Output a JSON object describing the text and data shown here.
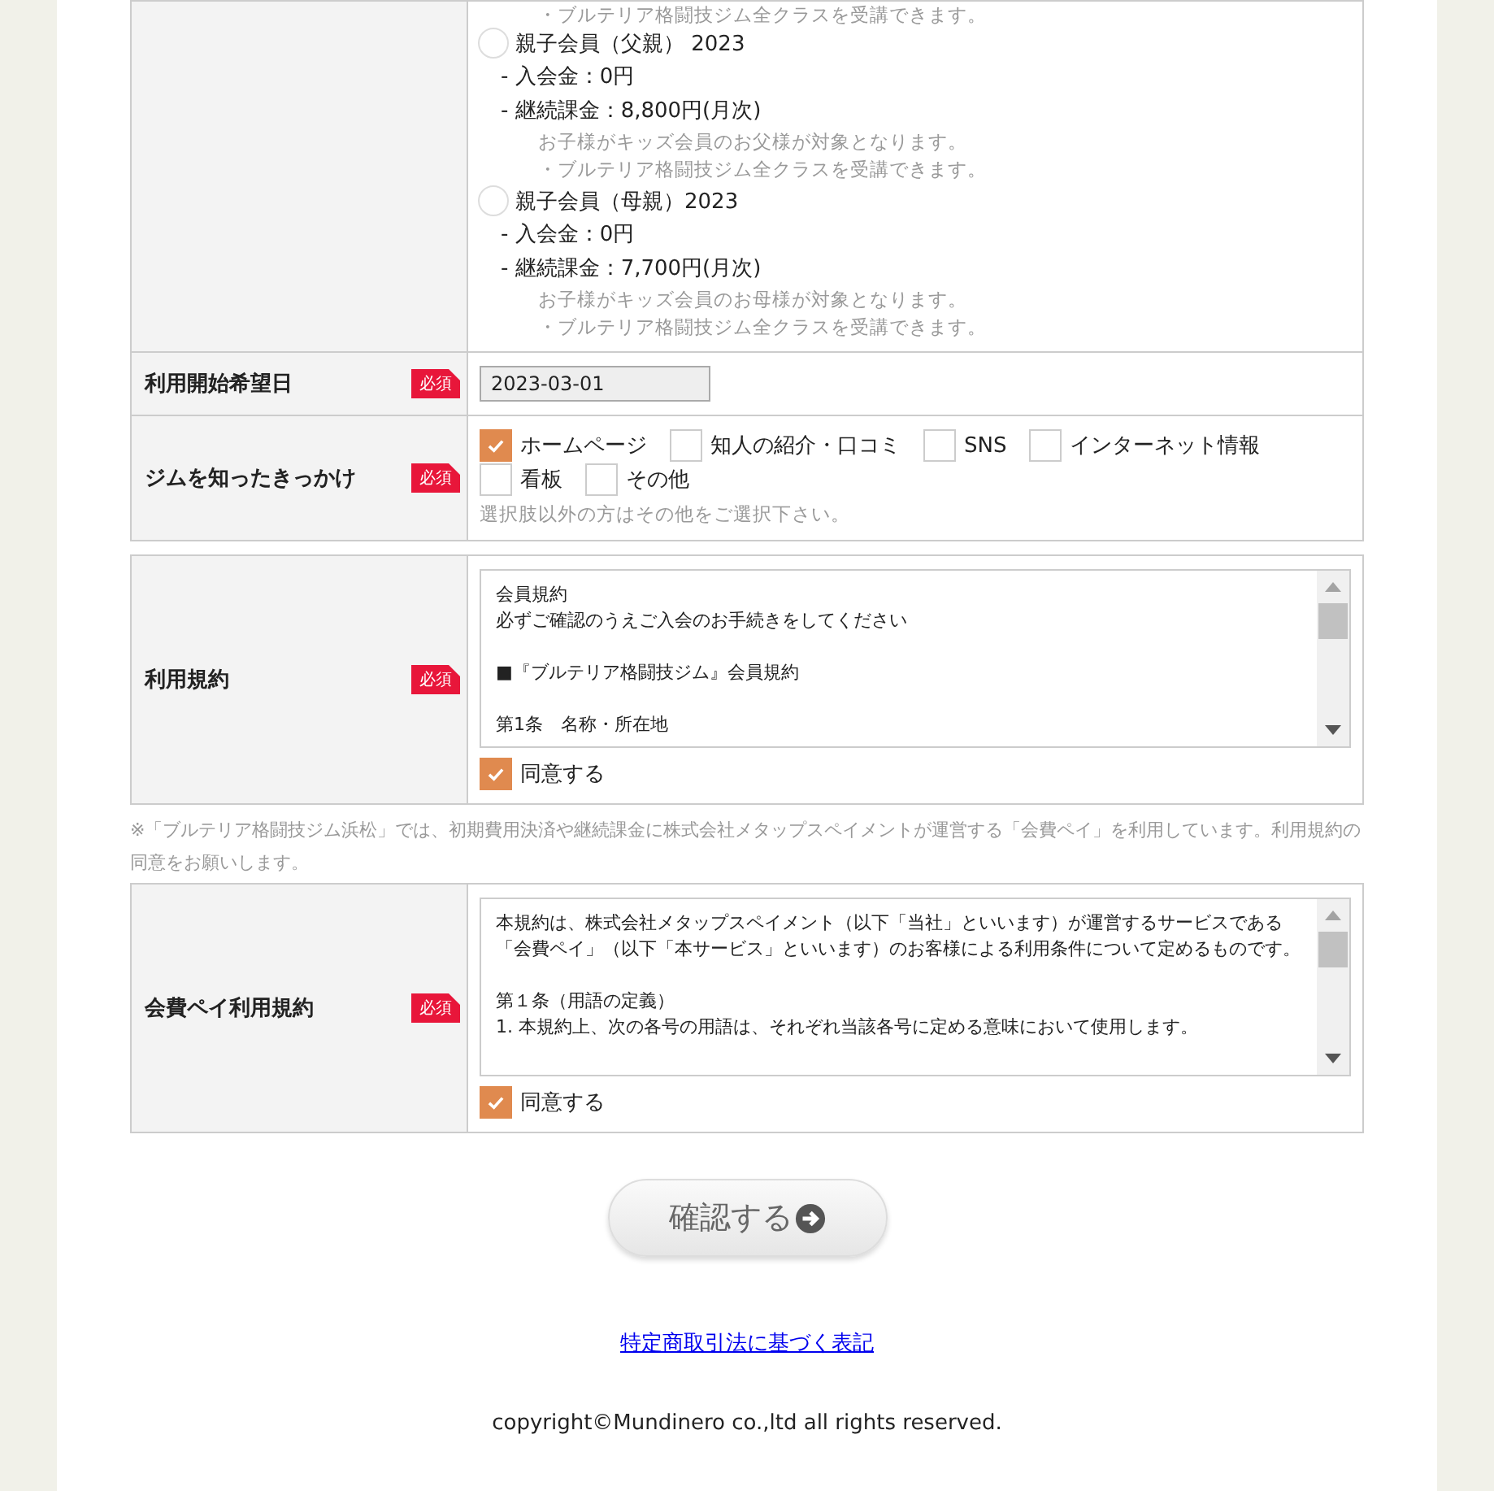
{
  "plans_top_note": "・ブルテリア格闘技ジム全クラスを受講できます。",
  "plans": [
    {
      "name": "親子会員（父親） 2023",
      "selected": false,
      "fees": [
        "- 入会金：0円",
        "- 継続課金：8,800円(月次)"
      ],
      "notes": [
        "お子様がキッズ会員のお父様が対象となります。",
        "・ブルテリア格闘技ジム全クラスを受講できます。"
      ]
    },
    {
      "name": "親子会員（母親）2023",
      "selected": false,
      "fees": [
        "- 入会金：0円",
        "- 継続課金：7,700円(月次)"
      ],
      "notes": [
        "お子様がキッズ会員のお母様が対象となります。",
        "・ブルテリア格闘技ジム全クラスを受講できます。"
      ]
    }
  ],
  "start_date": {
    "label": "利用開始希望日",
    "required": "必須",
    "value": "2023-03-01"
  },
  "referral": {
    "label": "ジムを知ったきっかけ",
    "required": "必須",
    "options": [
      {
        "label": "ホームページ",
        "checked": true
      },
      {
        "label": "知人の紹介・口コミ",
        "checked": false
      },
      {
        "label": "SNS",
        "checked": false
      },
      {
        "label": "インターネット情報",
        "checked": false
      },
      {
        "label": "看板",
        "checked": false
      },
      {
        "label": "その他",
        "checked": false
      }
    ],
    "hint": "選択肢以外の方はその他をご選択下さい。"
  },
  "terms": {
    "label": "利用規約",
    "required": "必須",
    "paragraphs": [
      [
        "会員規約",
        "必ずご確認のうえご入会のお手続きをしてください"
      ],
      [
        "■『ブルテリア格闘技ジム』会員規約"
      ],
      [
        "第1条　名称・所在地"
      ]
    ],
    "agree": {
      "label": "同意する",
      "checked": true
    }
  },
  "notice": "※「ブルテリア格闘技ジム浜松」では、初期費用決済や継続課金に株式会社メタップスペイメントが運営する「会費ペイ」を利用しています。利用規約の同意をお願いします。",
  "payment_terms": {
    "label": "会費ペイ利用規約",
    "required": "必須",
    "paragraphs": [
      [
        "本規約は、株式会社メタップスペイメント（以下「当社」といいます）が運営するサービスである「会費ペイ」（以下「本サービス」といいます）のお客様による利用条件について定めるものです。"
      ],
      [
        "第１条（用語の定義）",
        "1. 本規約上、次の各号の用語は、それぞれ当該各号に定める意味において使用します。"
      ]
    ],
    "agree": {
      "label": "同意する",
      "checked": true
    }
  },
  "confirm_button": "確認する",
  "legal_link": "特定商取引法に基づく表記",
  "copyright": "copyright©Mundinero co.,ltd all rights reserved."
}
